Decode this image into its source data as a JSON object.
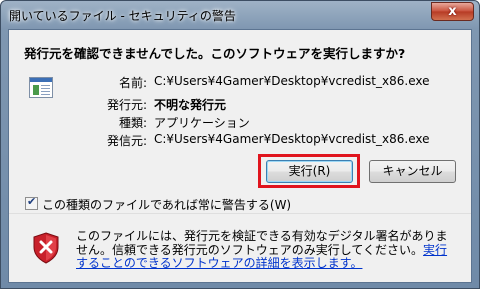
{
  "window": {
    "title": "開いているファイル - セキュリティの警告",
    "close_label": "x"
  },
  "dialog": {
    "heading": "発行元を確認できませんでした。このソフトウェアを実行しますか?",
    "fields": [
      {
        "label": "名前:",
        "value": "C:¥Users¥4Gamer¥Desktop¥vcredist_x86.exe"
      },
      {
        "label": "発行元:",
        "value": "不明な発行元"
      },
      {
        "label": "種類:",
        "value": "アプリケーション"
      },
      {
        "label": "発信元:",
        "value": "C:¥Users¥4Gamer¥Desktop¥vcredist_x86.exe"
      }
    ],
    "run_label": "実行(R)",
    "cancel_label": "キャンセル",
    "checkbox_label": "この種類のファイルであれば常に警告する(W)",
    "checkbox_checked": true,
    "warning_text": "このファイルには、発行元を検証できる有効なデジタル署名がありません。信頼できる発行元のソフトウェアのみ実行してください。",
    "warning_link": "実行することのできるソフトウェアの詳細を表示します。"
  },
  "colors": {
    "highlight_frame": "#e0141d",
    "link": "#0033cc"
  }
}
